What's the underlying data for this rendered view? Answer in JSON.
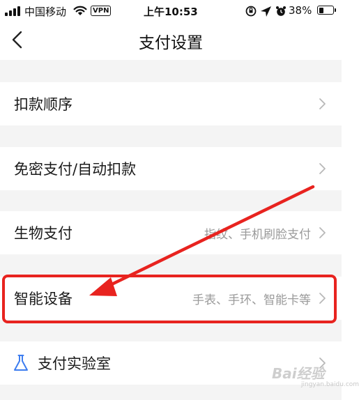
{
  "status_bar": {
    "carrier": "中国移动",
    "vpn": "VPN",
    "time": "上午10:53",
    "battery": "38%",
    "battery_level": 0.38
  },
  "nav": {
    "title": "支付设置"
  },
  "rows": [
    {
      "label": "扣款顺序",
      "value": ""
    },
    {
      "label": "免密支付/自动扣款",
      "value": ""
    },
    {
      "label": "生物支付",
      "value": "指纹、手机刷脸支付"
    },
    {
      "label": "智能设备",
      "value": "手表、手环、智能卡等"
    },
    {
      "label": "支付实验室",
      "value": ""
    }
  ],
  "annotation": {
    "color": "#e8231f",
    "highlighted_row": "智能设备"
  },
  "watermark": {
    "text": "Bai经验",
    "sub": "jingyan.baidu.com"
  }
}
